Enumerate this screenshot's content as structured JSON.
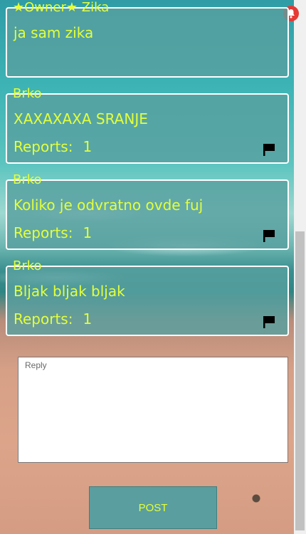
{
  "comments": [
    {
      "author": "★Owner★ Zika",
      "text": "ja sam zika"
    },
    {
      "author": "Brko",
      "text": "XAXAXAXA SRANJE",
      "reports_label": "Reports:",
      "reports_count": "1"
    },
    {
      "author": "Brko",
      "text": "Koliko je odvratno ovde fuj",
      "reports_label": "Reports:",
      "reports_count": "1"
    },
    {
      "author": "Brko",
      "text": "Bljak bljak bljak",
      "reports_label": "Reports:",
      "reports_count": "1"
    }
  ],
  "reply": {
    "placeholder": "Reply",
    "value": ""
  },
  "post_button": {
    "label": "POST"
  },
  "icons": {
    "notification": "bell-icon",
    "report": "flag-icon"
  },
  "colors": {
    "accent_text": "#e4ff3a",
    "card_bg": "#58a0a0",
    "notification": "#e53935"
  }
}
